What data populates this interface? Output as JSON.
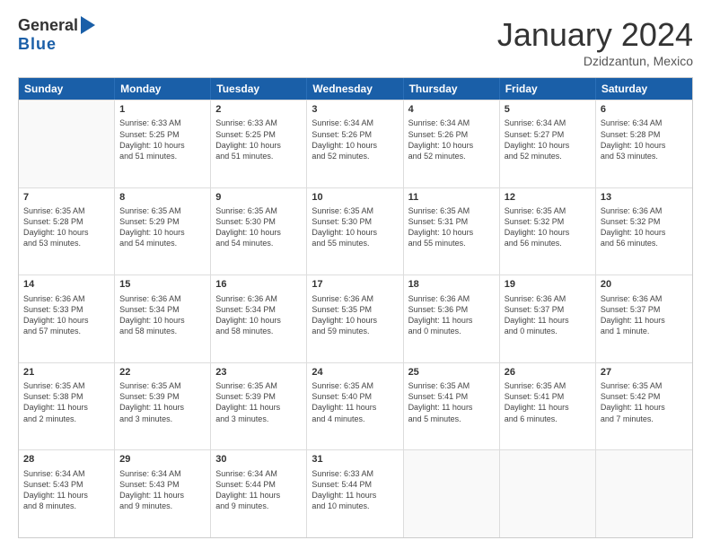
{
  "logo": {
    "general": "General",
    "blue": "Blue"
  },
  "header": {
    "month": "January 2024",
    "location": "Dzidzantun, Mexico"
  },
  "weekdays": [
    "Sunday",
    "Monday",
    "Tuesday",
    "Wednesday",
    "Thursday",
    "Friday",
    "Saturday"
  ],
  "rows": [
    [
      {
        "day": "",
        "info": ""
      },
      {
        "day": "1",
        "info": "Sunrise: 6:33 AM\nSunset: 5:25 PM\nDaylight: 10 hours\nand 51 minutes."
      },
      {
        "day": "2",
        "info": "Sunrise: 6:33 AM\nSunset: 5:25 PM\nDaylight: 10 hours\nand 51 minutes."
      },
      {
        "day": "3",
        "info": "Sunrise: 6:34 AM\nSunset: 5:26 PM\nDaylight: 10 hours\nand 52 minutes."
      },
      {
        "day": "4",
        "info": "Sunrise: 6:34 AM\nSunset: 5:26 PM\nDaylight: 10 hours\nand 52 minutes."
      },
      {
        "day": "5",
        "info": "Sunrise: 6:34 AM\nSunset: 5:27 PM\nDaylight: 10 hours\nand 52 minutes."
      },
      {
        "day": "6",
        "info": "Sunrise: 6:34 AM\nSunset: 5:28 PM\nDaylight: 10 hours\nand 53 minutes."
      }
    ],
    [
      {
        "day": "7",
        "info": "Sunrise: 6:35 AM\nSunset: 5:28 PM\nDaylight: 10 hours\nand 53 minutes."
      },
      {
        "day": "8",
        "info": "Sunrise: 6:35 AM\nSunset: 5:29 PM\nDaylight: 10 hours\nand 54 minutes."
      },
      {
        "day": "9",
        "info": "Sunrise: 6:35 AM\nSunset: 5:30 PM\nDaylight: 10 hours\nand 54 minutes."
      },
      {
        "day": "10",
        "info": "Sunrise: 6:35 AM\nSunset: 5:30 PM\nDaylight: 10 hours\nand 55 minutes."
      },
      {
        "day": "11",
        "info": "Sunrise: 6:35 AM\nSunset: 5:31 PM\nDaylight: 10 hours\nand 55 minutes."
      },
      {
        "day": "12",
        "info": "Sunrise: 6:35 AM\nSunset: 5:32 PM\nDaylight: 10 hours\nand 56 minutes."
      },
      {
        "day": "13",
        "info": "Sunrise: 6:36 AM\nSunset: 5:32 PM\nDaylight: 10 hours\nand 56 minutes."
      }
    ],
    [
      {
        "day": "14",
        "info": "Sunrise: 6:36 AM\nSunset: 5:33 PM\nDaylight: 10 hours\nand 57 minutes."
      },
      {
        "day": "15",
        "info": "Sunrise: 6:36 AM\nSunset: 5:34 PM\nDaylight: 10 hours\nand 58 minutes."
      },
      {
        "day": "16",
        "info": "Sunrise: 6:36 AM\nSunset: 5:34 PM\nDaylight: 10 hours\nand 58 minutes."
      },
      {
        "day": "17",
        "info": "Sunrise: 6:36 AM\nSunset: 5:35 PM\nDaylight: 10 hours\nand 59 minutes."
      },
      {
        "day": "18",
        "info": "Sunrise: 6:36 AM\nSunset: 5:36 PM\nDaylight: 11 hours\nand 0 minutes."
      },
      {
        "day": "19",
        "info": "Sunrise: 6:36 AM\nSunset: 5:37 PM\nDaylight: 11 hours\nand 0 minutes."
      },
      {
        "day": "20",
        "info": "Sunrise: 6:36 AM\nSunset: 5:37 PM\nDaylight: 11 hours\nand 1 minute."
      }
    ],
    [
      {
        "day": "21",
        "info": "Sunrise: 6:35 AM\nSunset: 5:38 PM\nDaylight: 11 hours\nand 2 minutes."
      },
      {
        "day": "22",
        "info": "Sunrise: 6:35 AM\nSunset: 5:39 PM\nDaylight: 11 hours\nand 3 minutes."
      },
      {
        "day": "23",
        "info": "Sunrise: 6:35 AM\nSunset: 5:39 PM\nDaylight: 11 hours\nand 3 minutes."
      },
      {
        "day": "24",
        "info": "Sunrise: 6:35 AM\nSunset: 5:40 PM\nDaylight: 11 hours\nand 4 minutes."
      },
      {
        "day": "25",
        "info": "Sunrise: 6:35 AM\nSunset: 5:41 PM\nDaylight: 11 hours\nand 5 minutes."
      },
      {
        "day": "26",
        "info": "Sunrise: 6:35 AM\nSunset: 5:41 PM\nDaylight: 11 hours\nand 6 minutes."
      },
      {
        "day": "27",
        "info": "Sunrise: 6:35 AM\nSunset: 5:42 PM\nDaylight: 11 hours\nand 7 minutes."
      }
    ],
    [
      {
        "day": "28",
        "info": "Sunrise: 6:34 AM\nSunset: 5:43 PM\nDaylight: 11 hours\nand 8 minutes."
      },
      {
        "day": "29",
        "info": "Sunrise: 6:34 AM\nSunset: 5:43 PM\nDaylight: 11 hours\nand 9 minutes."
      },
      {
        "day": "30",
        "info": "Sunrise: 6:34 AM\nSunset: 5:44 PM\nDaylight: 11 hours\nand 9 minutes."
      },
      {
        "day": "31",
        "info": "Sunrise: 6:33 AM\nSunset: 5:44 PM\nDaylight: 11 hours\nand 10 minutes."
      },
      {
        "day": "",
        "info": ""
      },
      {
        "day": "",
        "info": ""
      },
      {
        "day": "",
        "info": ""
      }
    ]
  ]
}
